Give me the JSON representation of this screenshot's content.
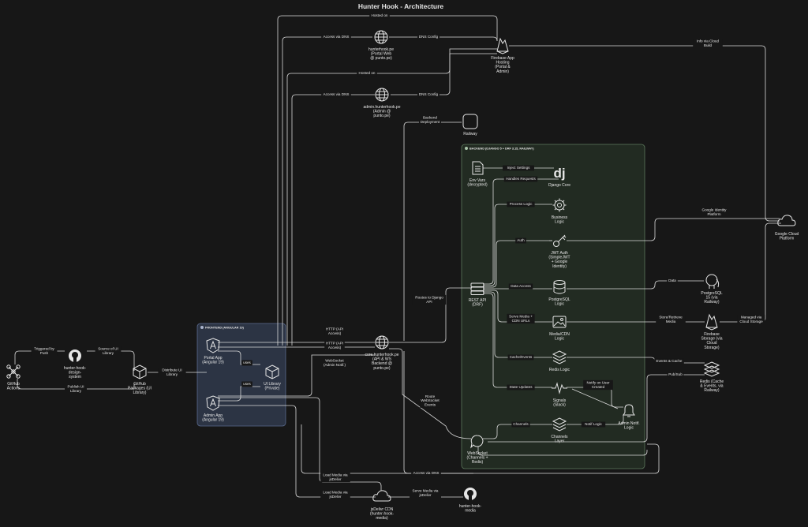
{
  "title": "Hunter Hook - Architecture",
  "groups": {
    "frontend": "FRONTEND (ANGULAR 19)",
    "backend": "BACKEND (DJANGO 5 + DRF 3.15, RAILWAY)"
  },
  "nodes": {
    "github_actions": [
      "GitHub",
      "Actions"
    ],
    "design_system": [
      "hunter-hook-",
      "design-",
      "system"
    ],
    "github_packages": [
      "GitHub",
      "Packages (UI",
      "Library)"
    ],
    "portal_app": [
      "Portal App",
      "(Angular 19)"
    ],
    "admin_app": [
      "Admin App",
      "(Angular 19)"
    ],
    "ui_library": [
      "UI Library",
      "(Private)"
    ],
    "portal_domain": [
      "hunterhook.pe",
      "(Portal Web",
      "@ punto.pe)"
    ],
    "admin_domain": [
      "admin.hunterhook.pe",
      "(Admin @",
      "punto.pe)"
    ],
    "firebase_hosting": [
      "Firebase App",
      "Hosting",
      "(Portal &",
      "Admin)"
    ],
    "railway": [
      "Railway"
    ],
    "core_domain": [
      "core.hunterhook.pe",
      "(API & WS",
      "Backend @",
      "punto.pe)"
    ],
    "env_vars": [
      "Env Vars",
      "(decrypted)"
    ],
    "django_core": [
      "Django Core"
    ],
    "business_logic": [
      "Business",
      "Logic"
    ],
    "jwt_auth": [
      "JWT Auth",
      "(SimpleJWT",
      "+ Google",
      "Identity)"
    ],
    "rest_api": [
      "REST API",
      "(DRF)"
    ],
    "postgres_logic": [
      "PostgreSQL",
      "Logic"
    ],
    "media_logic": [
      "Media/CDN",
      "Logic"
    ],
    "redis_logic": [
      "Redis Logic"
    ],
    "signals": [
      "Signals",
      "(Slack)"
    ],
    "admin_notif": [
      "Admin Notif.",
      "Logic"
    ],
    "channels_layer": [
      "Channels",
      "Layer"
    ],
    "websocket": [
      "WebSocket",
      "(Channels +",
      "Redis)"
    ],
    "postgresql": [
      "PostgreSQL",
      "15 (via",
      "Railway)"
    ],
    "firebase_storage": [
      "Firebase",
      "Storage (via",
      "Cloud",
      "Storage)"
    ],
    "redis": [
      "Redis (Cache",
      "& Events, via",
      "Railway)"
    ],
    "gcp": [
      "Google Cloud",
      "Platform"
    ],
    "jsdelivr": [
      "jsDelivr CDN",
      "(hunter-hook-",
      "media)"
    ],
    "hunter_media": [
      "hunter-hook-",
      "media"
    ]
  },
  "edges": {
    "triggered_by_push": [
      "Triggered by",
      "Push"
    ],
    "source_ui": [
      "Source of UI",
      "Library"
    ],
    "publish_ui": [
      "Publish UI",
      "Library"
    ],
    "distribute_ui": [
      "Distribute UI",
      "Library"
    ],
    "uses_1": [
      "uses"
    ],
    "uses_2": [
      "uses"
    ],
    "hosted_on_1": [
      "Hosted on"
    ],
    "hosted_on_2": [
      "Hosted on"
    ],
    "access_dns_1": [
      "Access via DNS"
    ],
    "access_dns_2": [
      "Access via DNS"
    ],
    "dns_config_1": [
      "DNS Config"
    ],
    "dns_config_2": [
      "DNS Config"
    ],
    "info_cloud_build": [
      "Info via Cloud",
      "Build"
    ],
    "backend_deploy": [
      "Backend",
      "Deployment"
    ],
    "http_api_1": [
      "HTTP (API",
      "Access)"
    ],
    "http_api_2": [
      "HTTP (API",
      "Access)"
    ],
    "websocket_admin": [
      "WebSocket",
      "(Admin Notif.)"
    ],
    "routes_django": [
      "Routes to Django",
      "API"
    ],
    "routes_ws": [
      "Route",
      "WebSocket",
      "Events"
    ],
    "inject_settings": [
      "Inject Settings"
    ],
    "handles_requests": [
      "Handles Requests"
    ],
    "process_logic": [
      "Process Logic"
    ],
    "auth": [
      "Auth"
    ],
    "google_identity": [
      "Google Identity",
      "Platform"
    ],
    "data_access": [
      "Data Access"
    ],
    "data": [
      "Data"
    ],
    "serve_media_cdn": [
      "Serve Media +",
      "CDN URLs"
    ],
    "store_retrieve": [
      "Store/Retrieve",
      "Media"
    ],
    "managed_cloud_storage": [
      "Managed via",
      "Cloud Storage"
    ],
    "cache_events": [
      "Cache/Events"
    ],
    "events_cache": [
      "Events & Cache"
    ],
    "pubsub": [
      "Pub/Sub"
    ],
    "state_updates": [
      "State Updates"
    ],
    "notify_user_created": [
      "Notify on User",
      "Created"
    ],
    "channels": [
      "Channels"
    ],
    "notif_logic": [
      "Notif Logic"
    ],
    "access_dns_ws": [
      "Access via DNS"
    ],
    "load_media_1": [
      "Load Media via",
      "jsDelivr"
    ],
    "load_media_2": [
      "Load Media via",
      "jsDelivr"
    ],
    "serve_jsdelivr": [
      "Serve Media via",
      "jsDelivr"
    ]
  },
  "icons": {
    "github_actions": "workflow-icon",
    "design_system": "github-icon",
    "github_packages": "package-icon",
    "portal_app": "angular-icon",
    "admin_app": "angular-icon",
    "ui_library": "package-icon",
    "portal_domain": "globe-icon",
    "admin_domain": "globe-icon",
    "firebase_hosting": "firebase-icon",
    "railway": "railway-icon",
    "core_domain": "globe-icon",
    "env_vars": "document-icon",
    "django_core": "django-icon",
    "business_logic": "gear-icon",
    "jwt_auth": "key-icon",
    "rest_api": "server-icon",
    "postgres_logic": "database-icon",
    "media_logic": "image-icon",
    "redis_logic": "layers-icon",
    "signals": "signal-icon",
    "admin_notif": "bell-icon",
    "channels_layer": "layers-icon",
    "websocket": "chat-icon",
    "postgresql": "elephant-icon",
    "firebase_storage": "firebase-icon",
    "redis": "redis-icon",
    "gcp": "cloud-icon",
    "jsdelivr": "cloud-icon",
    "hunter_media": "github-icon"
  },
  "colors": {
    "background": "#171717",
    "frontend_fill": "#2c3444",
    "frontend_stroke": "#5b6b8f",
    "backend_fill": "#222b22",
    "backend_stroke": "#5d7a5d",
    "edge": "#d9d9d9",
    "text": "#e6e6e6"
  }
}
